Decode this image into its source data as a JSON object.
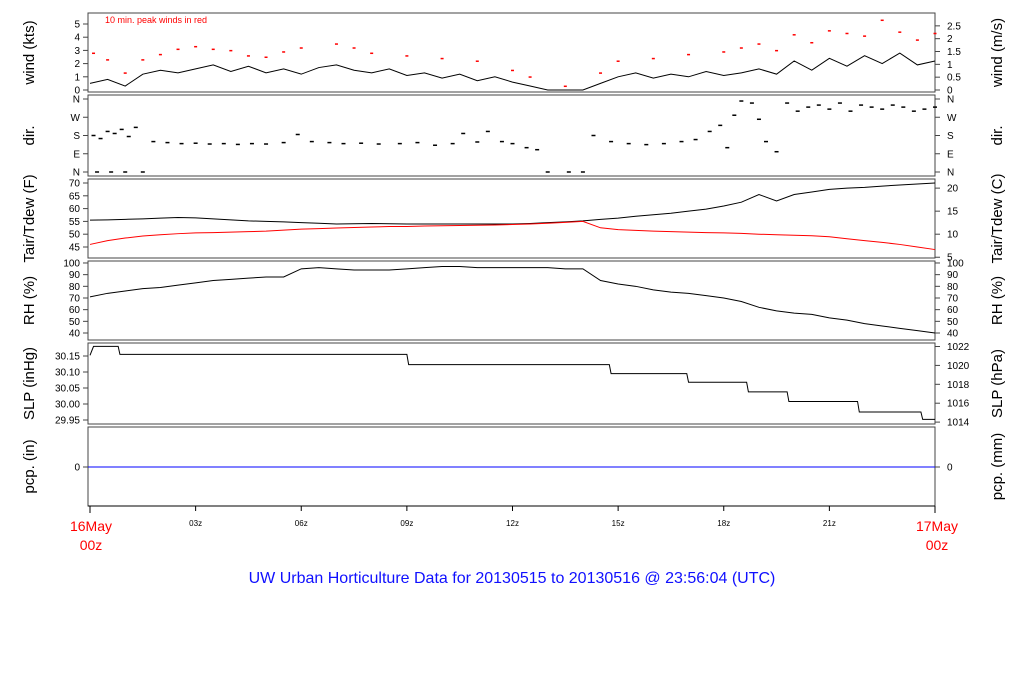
{
  "chart_data": {
    "type": "line",
    "title": "UW Urban Horticulture Data for 20130515  to  20130516 @ 23:56:04  (UTC)",
    "x_ticks": [
      {
        "h": 3,
        "label": "03z"
      },
      {
        "h": 6,
        "label": "06z"
      },
      {
        "h": 9,
        "label": "09z"
      },
      {
        "h": 12,
        "label": "12z"
      },
      {
        "h": 15,
        "label": "15z"
      },
      {
        "h": 18,
        "label": "18z"
      },
      {
        "h": 21,
        "label": "21z"
      }
    ],
    "x_start": {
      "line1": "16May",
      "line2": "00z"
    },
    "x_end": {
      "line1": "17May",
      "line2": "00z"
    },
    "xlim_hours": [
      0,
      24
    ],
    "colors": {
      "main": "#000000",
      "peak": "#ff0000",
      "dew": "#ff0000",
      "pcp": "#0000ff",
      "title": "#1010ff",
      "date": "#ff0000"
    },
    "panels": {
      "wind": {
        "ylabel_left": "wind (kts)",
        "ylabel_right": "wind (m/s)",
        "note": "10 min. peak winds in red",
        "ylim": [
          0,
          5.5
        ],
        "left_ticks": [
          "0",
          "1",
          "2",
          "3",
          "4",
          "5"
        ],
        "right_ticks": [
          "0",
          "0.5",
          "1",
          "1.5",
          "2",
          "2.5"
        ],
        "step_hours": 0.5,
        "speed_kts": [
          0.5,
          0.8,
          0.3,
          1.2,
          1.5,
          1.3,
          1.6,
          1.9,
          1.4,
          1.8,
          1.3,
          1.6,
          1.2,
          1.7,
          1.9,
          1.5,
          1.3,
          1.6,
          1.1,
          1.3,
          0.9,
          1.2,
          0.7,
          1.0,
          0.6,
          0.3,
          0,
          0,
          0,
          0.5,
          1.0,
          1.3,
          0.9,
          1.2,
          1.0,
          1.4,
          1.1,
          1.3,
          1.6,
          1.2,
          2.2,
          1.5,
          2.4,
          1.8,
          2.6,
          2.0,
          2.8,
          1.9,
          2.2
        ],
        "peaks_kts": [
          [
            0.1,
            2.8
          ],
          [
            0.5,
            2.3
          ],
          [
            1,
            1.3
          ],
          [
            1.5,
            2.3
          ],
          [
            2,
            2.7
          ],
          [
            2.5,
            3.1
          ],
          [
            3,
            3.3
          ],
          [
            3.5,
            3.1
          ],
          [
            4,
            3.0
          ],
          [
            4.5,
            2.6
          ],
          [
            5,
            2.5
          ],
          [
            5.5,
            2.9
          ],
          [
            6,
            3.2
          ],
          [
            7,
            3.5
          ],
          [
            7.5,
            3.2
          ],
          [
            8,
            2.8
          ],
          [
            9,
            2.6
          ],
          [
            10,
            2.4
          ],
          [
            11,
            2.2
          ],
          [
            12,
            1.5
          ],
          [
            12.5,
            1.0
          ],
          [
            13.5,
            0.3
          ],
          [
            14.5,
            1.3
          ],
          [
            15,
            2.2
          ],
          [
            16,
            2.4
          ],
          [
            17,
            2.7
          ],
          [
            18,
            2.9
          ],
          [
            18.5,
            3.2
          ],
          [
            19,
            3.5
          ],
          [
            19.5,
            3.0
          ],
          [
            20,
            4.2
          ],
          [
            20.5,
            3.6
          ],
          [
            21,
            4.5
          ],
          [
            21.5,
            4.3
          ],
          [
            22,
            4.1
          ],
          [
            22.5,
            5.3
          ],
          [
            23,
            4.4
          ],
          [
            23.5,
            3.8
          ],
          [
            24,
            4.3
          ]
        ]
      },
      "dir": {
        "ylabel_left": "dir.",
        "ylabel_right": "dir.",
        "ylim": [
          0,
          360
        ],
        "ticks": [
          "N",
          "E",
          "S",
          "W",
          "N"
        ],
        "points_deg": [
          [
            0.1,
            180
          ],
          [
            0.3,
            165
          ],
          [
            0.5,
            200
          ],
          [
            0.7,
            190
          ],
          [
            0.9,
            210
          ],
          [
            1.1,
            175
          ],
          [
            1.3,
            220
          ],
          [
            0.2,
            0
          ],
          [
            0.6,
            0
          ],
          [
            1.0,
            0
          ],
          [
            1.5,
            0
          ],
          [
            1.8,
            150
          ],
          [
            2.2,
            145
          ],
          [
            2.6,
            140
          ],
          [
            3,
            142
          ],
          [
            3.4,
            138
          ],
          [
            3.8,
            140
          ],
          [
            4.2,
            136
          ],
          [
            4.6,
            140
          ],
          [
            5,
            138
          ],
          [
            5.5,
            145
          ],
          [
            5.9,
            185
          ],
          [
            6.3,
            150
          ],
          [
            6.8,
            145
          ],
          [
            7.2,
            140
          ],
          [
            7.7,
            142
          ],
          [
            8.2,
            138
          ],
          [
            8.8,
            140
          ],
          [
            9.3,
            145
          ],
          [
            9.8,
            132
          ],
          [
            10.3,
            140
          ],
          [
            10.6,
            190
          ],
          [
            11,
            148
          ],
          [
            11.3,
            200
          ],
          [
            11.7,
            150
          ],
          [
            12,
            140
          ],
          [
            12.4,
            120
          ],
          [
            12.7,
            110
          ],
          [
            13,
            0
          ],
          [
            13.6,
            0
          ],
          [
            14,
            0
          ],
          [
            14.3,
            180
          ],
          [
            14.8,
            150
          ],
          [
            15.3,
            140
          ],
          [
            15.8,
            135
          ],
          [
            16.3,
            140
          ],
          [
            16.8,
            150
          ],
          [
            17.2,
            160
          ],
          [
            17.6,
            200
          ],
          [
            17.9,
            230
          ],
          [
            18.1,
            120
          ],
          [
            18.3,
            280
          ],
          [
            18.5,
            350
          ],
          [
            18.8,
            340
          ],
          [
            19.0,
            260
          ],
          [
            19.2,
            150
          ],
          [
            19.5,
            100
          ],
          [
            19.8,
            340
          ],
          [
            20.1,
            300
          ],
          [
            20.4,
            320
          ],
          [
            20.7,
            330
          ],
          [
            21,
            310
          ],
          [
            21.3,
            340
          ],
          [
            21.6,
            300
          ],
          [
            21.9,
            330
          ],
          [
            22.2,
            320
          ],
          [
            22.5,
            310
          ],
          [
            22.8,
            330
          ],
          [
            23.1,
            320
          ],
          [
            23.4,
            300
          ],
          [
            23.7,
            310
          ],
          [
            24,
            320
          ]
        ]
      },
      "temp": {
        "ylabel_left": "Tair/Tdew (F)",
        "ylabel_right": "Tair/Tdew (C)",
        "ylim": [
          40,
          71.5
        ],
        "left_ticks": [
          "45",
          "50",
          "55",
          "60",
          "65",
          "70"
        ],
        "right_ticks": [
          "5",
          "10",
          "15",
          "20"
        ],
        "step_hours": 0.5,
        "tair_f": [
          55.5,
          55.6,
          55.8,
          56.0,
          56.3,
          56.5,
          56.4,
          56.0,
          55.6,
          55.2,
          55.0,
          54.8,
          54.5,
          54.3,
          54.0,
          54.1,
          54.2,
          54.1,
          54.0,
          54.0,
          54.0,
          54.0,
          54.0,
          54.0,
          54.0,
          54.2,
          54.5,
          54.8,
          55.2,
          55.8,
          56.3,
          57.0,
          57.6,
          58.2,
          59.0,
          59.8,
          61.0,
          62.5,
          65.5,
          63.0,
          65.5,
          66.5,
          67.5,
          68.0,
          68.3,
          68.8,
          69.2,
          69.6,
          70.0
        ],
        "tdew_f": [
          46.0,
          47.5,
          48.5,
          49.3,
          49.8,
          50.2,
          50.5,
          50.6,
          50.8,
          51.0,
          51.2,
          51.6,
          52.0,
          52.2,
          52.4,
          52.6,
          52.8,
          53.0,
          53.0,
          53.2,
          53.3,
          53.4,
          53.5,
          53.6,
          53.8,
          54.0,
          54.3,
          54.6,
          55.0,
          52.5,
          51.8,
          51.5,
          51.2,
          51.0,
          50.8,
          50.6,
          50.5,
          50.3,
          50.0,
          49.8,
          49.6,
          49.4,
          49.0,
          48.2,
          47.5,
          46.8,
          46.0,
          45.0,
          44.0
        ]
      },
      "rh": {
        "ylabel_left": "RH (%)",
        "ylabel_right": "RH (%)",
        "ylim": [
          38,
          100
        ],
        "ticks": [
          "40",
          "50",
          "60",
          "70",
          "80",
          "90",
          "100"
        ],
        "step_hours": 0.5,
        "rh_pct": [
          71,
          74,
          76,
          78,
          79,
          81,
          83,
          85,
          86,
          87,
          88,
          88,
          95,
          96,
          95,
          94,
          94,
          94,
          95,
          96,
          97,
          97,
          96,
          96,
          96,
          96,
          96,
          95,
          95,
          85,
          82,
          80,
          77,
          75,
          74,
          72,
          70,
          67,
          62,
          59,
          57,
          56,
          53,
          51,
          48,
          46,
          44,
          42,
          40
        ]
      },
      "slp": {
        "ylabel_left": "SLP (inHg)",
        "ylabel_right": "SLP (hPa)",
        "ylim": [
          29.94,
          30.19
        ],
        "left_ticks": [
          "29.95",
          "30.00",
          "30.05",
          "30.10",
          "30.15"
        ],
        "right_ticks": [
          "1014",
          "1016",
          "1018",
          "1020",
          "1022"
        ],
        "steps_inhg": [
          [
            0,
            30.152
          ],
          [
            0.1,
            30.18
          ],
          [
            0.8,
            30.18
          ],
          [
            0.85,
            30.155
          ],
          [
            9,
            30.155
          ],
          [
            9.05,
            30.123
          ],
          [
            14.75,
            30.123
          ],
          [
            14.8,
            30.095
          ],
          [
            16.95,
            30.095
          ],
          [
            17,
            30.068
          ],
          [
            18.65,
            30.068
          ],
          [
            18.7,
            30.038
          ],
          [
            19.8,
            30.038
          ],
          [
            19.85,
            30.008
          ],
          [
            21.8,
            30.008
          ],
          [
            21.85,
            29.975
          ],
          [
            23.6,
            29.975
          ],
          [
            23.65,
            29.952
          ],
          [
            24,
            29.952
          ]
        ]
      },
      "pcp": {
        "ylabel_left": "pcp. (in)",
        "ylabel_right": "pcp. (mm)",
        "left_ticks": [
          "0"
        ],
        "right_ticks": [
          "0"
        ],
        "value": 0
      }
    }
  }
}
